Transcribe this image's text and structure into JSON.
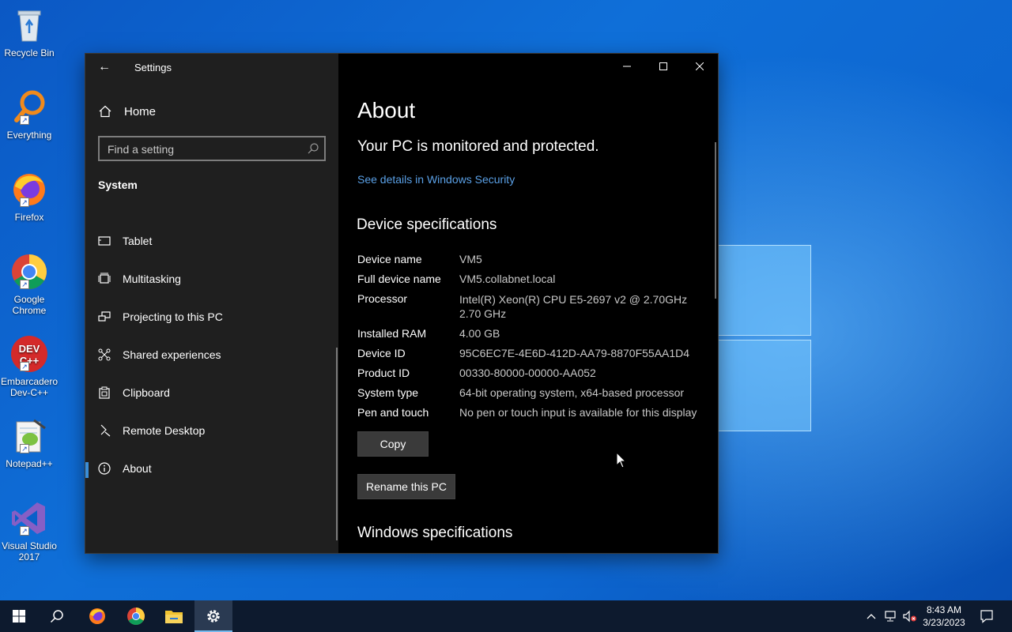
{
  "desktop": {
    "icons": [
      {
        "label": "Recycle Bin"
      },
      {
        "label": "Everything"
      },
      {
        "label": "Firefox"
      },
      {
        "label": "Google Chrome"
      },
      {
        "label": "Embarcadero Dev-C++"
      },
      {
        "label": "Notepad++"
      },
      {
        "label": "Visual Studio 2017"
      }
    ]
  },
  "window": {
    "title": "Settings",
    "sidebar": {
      "home_label": "Home",
      "search_placeholder": "Find a setting",
      "group_title": "System",
      "items": [
        {
          "label": "Tablet",
          "icon": "tablet-icon"
        },
        {
          "label": "Multitasking",
          "icon": "multitasking-icon"
        },
        {
          "label": "Projecting to this PC",
          "icon": "projecting-icon"
        },
        {
          "label": "Shared experiences",
          "icon": "shared-experiences-icon"
        },
        {
          "label": "Clipboard",
          "icon": "clipboard-icon"
        },
        {
          "label": "Remote Desktop",
          "icon": "remote-desktop-icon"
        },
        {
          "label": "About",
          "icon": "info-icon",
          "selected": true
        }
      ]
    },
    "content": {
      "page_title": "About",
      "monitored": "Your PC is monitored and protected.",
      "security_link": "See details in Windows Security",
      "device_specs_title": "Device specifications",
      "specs": [
        {
          "key": "Device name",
          "value": "VM5"
        },
        {
          "key": "Full device name",
          "value": "VM5.collabnet.local"
        },
        {
          "key": "Processor",
          "value": "Intel(R) Xeon(R) CPU E5-2697 v2 @ 2.70GHz",
          "value2": "2.70 GHz"
        },
        {
          "key": "Installed RAM",
          "value": "4.00 GB"
        },
        {
          "key": "Device ID",
          "value": "95C6EC7E-4E6D-412D-AA79-8870F55AA1D4"
        },
        {
          "key": "Product ID",
          "value": "00330-80000-00000-AA052"
        },
        {
          "key": "System type",
          "value": "64-bit operating system, x64-based processor"
        },
        {
          "key": "Pen and touch",
          "value": "No pen or touch input is available for this display"
        }
      ],
      "copy_label": "Copy",
      "rename_label": "Rename this PC",
      "windows_specs_title": "Windows specifications"
    }
  },
  "taskbar": {
    "time": "8:43 AM",
    "date": "3/23/2023"
  },
  "colors": {
    "accent": "#3b8ed8",
    "link": "#5aa0e6",
    "sidebar_bg": "#1f1f1f",
    "content_bg": "#000000"
  }
}
